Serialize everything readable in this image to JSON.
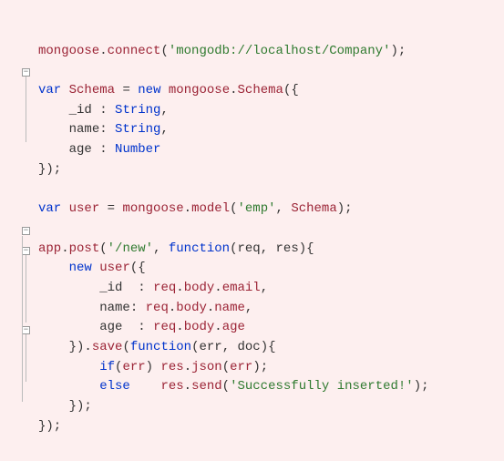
{
  "code": {
    "l1_mongoose": "mongoose",
    "l1_connect": "connect",
    "l1_conn_str": "'mongodb://localhost/Company'",
    "l3_var": "var",
    "l3_Schema": "Schema",
    "l3_new": "new",
    "l3_mongoose": "mongoose",
    "l3_SchemaCtor": "Schema",
    "l4_id": "_id",
    "l4_type": "String",
    "l5_name": "name",
    "l5_type": "String",
    "l6_age": "age",
    "l6_type": "Number",
    "l9_var": "var",
    "l9_user": "user",
    "l9_mongoose": "mongoose",
    "l9_model": "model",
    "l9_emp": "'emp'",
    "l9_Schema": "Schema",
    "l11_app": "app",
    "l11_post": "post",
    "l11_route": "'/new'",
    "l11_function": "function",
    "l11_req": "req",
    "l11_res": "res",
    "l12_new": "new",
    "l12_user": "user",
    "l13_id": "_id",
    "l13_req": "req",
    "l13_body": "body",
    "l13_email": "email",
    "l14_name": "name",
    "l14_req": "req",
    "l14_body": "body",
    "l14_nameProp": "name",
    "l15_age": "age",
    "l15_req": "req",
    "l15_body": "body",
    "l15_ageProp": "age",
    "l16_save": "save",
    "l16_function": "function",
    "l16_err": "err",
    "l16_doc": "doc",
    "l17_if": "if",
    "l17_err": "err",
    "l17_res": "res",
    "l17_json": "json",
    "l17_errArg": "err",
    "l18_else": "else",
    "l18_res": "res",
    "l18_send": "send",
    "l18_msg": "'Successfully inserted!'"
  }
}
